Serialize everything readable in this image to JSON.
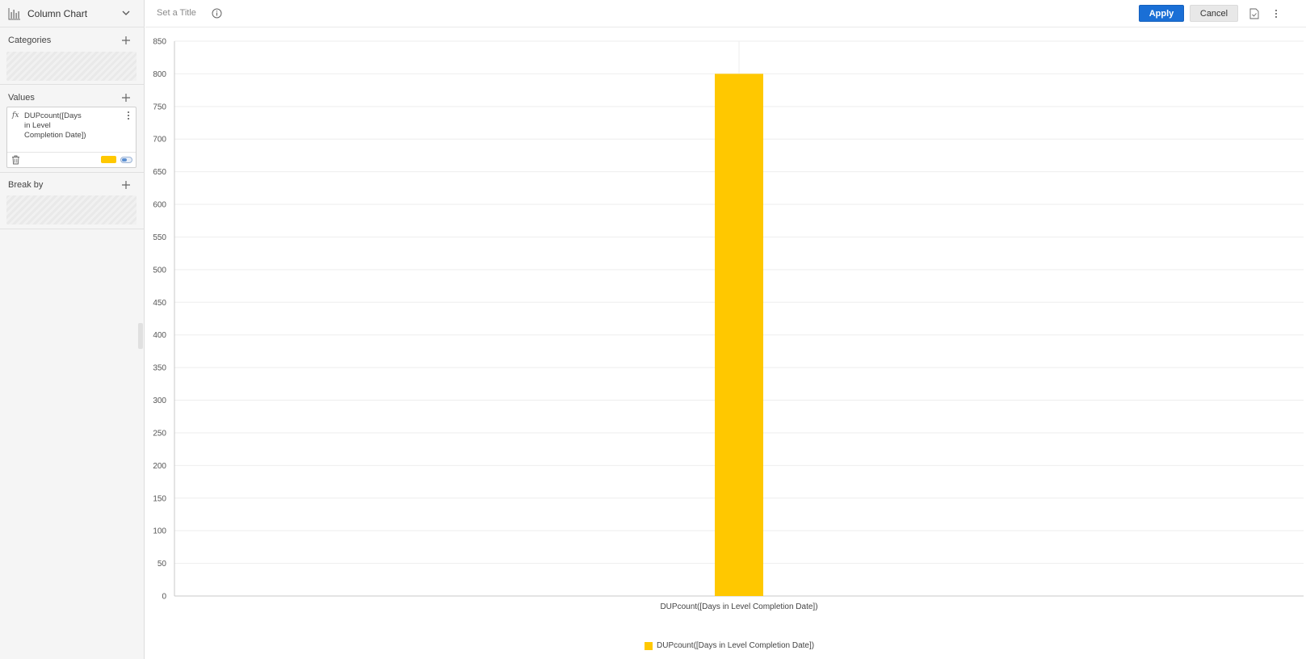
{
  "sidebar": {
    "chart_type": {
      "label": "Column Chart",
      "icon": "column-chart-icon"
    },
    "categories": {
      "title": "Categories"
    },
    "values": {
      "title": "Values",
      "items": [
        {
          "fx": "fx",
          "name": "DUPcount([Days in Level Completion Date])",
          "color": "#FFC800"
        }
      ]
    },
    "break_by": {
      "title": "Break by"
    }
  },
  "header": {
    "title_placeholder": "Set a Title",
    "apply_label": "Apply",
    "cancel_label": "Cancel"
  },
  "colors": {
    "accent": "#1A6FD6",
    "bar": "#FFC800",
    "gridline": "#EEEEEE",
    "axis": "#C8C8C8"
  },
  "chart_data": {
    "type": "bar",
    "categories": [
      "DUPcount([Days in Level Completion Date])"
    ],
    "series": [
      {
        "name": "DUPcount([Days in Level Completion Date])",
        "values": [
          800
        ],
        "color": "#FFC800"
      }
    ],
    "title": "",
    "xlabel": "",
    "ylabel": "",
    "ylim": [
      0,
      850
    ],
    "yticks": [
      0,
      50,
      100,
      150,
      200,
      250,
      300,
      350,
      400,
      450,
      500,
      550,
      600,
      650,
      700,
      750,
      800,
      850
    ],
    "grid": true,
    "legend_position": "bottom"
  }
}
